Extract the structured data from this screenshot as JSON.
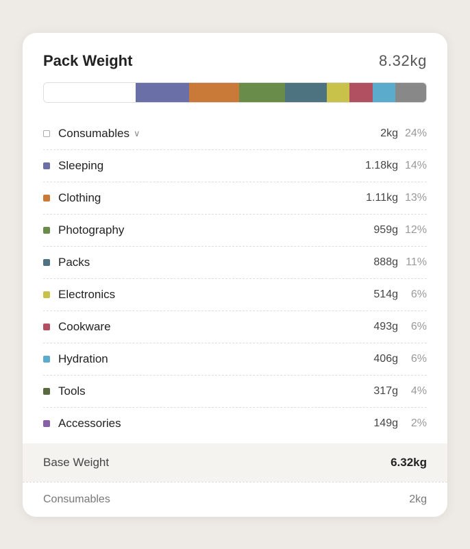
{
  "header": {
    "title": "Pack Weight",
    "total_weight": "8.32kg"
  },
  "bar": {
    "segments": [
      {
        "color": "#ffffff",
        "flex": 24,
        "border": true
      },
      {
        "color": "#6b6fa8",
        "flex": 14
      },
      {
        "color": "#c97a38",
        "flex": 13
      },
      {
        "color": "#6a8c4a",
        "flex": 12
      },
      {
        "color": "#4e7380",
        "flex": 11
      },
      {
        "color": "#c8c14a",
        "flex": 6
      },
      {
        "color": "#b05060",
        "flex": 6
      },
      {
        "color": "#5aabcc",
        "flex": 6
      },
      {
        "color": "#888",
        "flex": 8
      }
    ]
  },
  "items": [
    {
      "name": "Consumables",
      "has_chevron": true,
      "color": "#ffffff",
      "color_border": "#aaa",
      "weight": "2kg",
      "percent": "24%"
    },
    {
      "name": "Sleeping",
      "has_chevron": false,
      "color": "#6b6fa8",
      "weight": "1.18kg",
      "percent": "14%"
    },
    {
      "name": "Clothing",
      "has_chevron": false,
      "color": "#c97a38",
      "weight": "1.11kg",
      "percent": "13%"
    },
    {
      "name": "Photography",
      "has_chevron": false,
      "color": "#6a8c4a",
      "weight": "959g",
      "percent": "12%"
    },
    {
      "name": "Packs",
      "has_chevron": false,
      "color": "#4e7380",
      "weight": "888g",
      "percent": "11%"
    },
    {
      "name": "Electronics",
      "has_chevron": false,
      "color": "#c8c14a",
      "weight": "514g",
      "percent": "6%"
    },
    {
      "name": "Cookware",
      "has_chevron": false,
      "color": "#b05060",
      "weight": "493g",
      "percent": "6%"
    },
    {
      "name": "Hydration",
      "has_chevron": false,
      "color": "#5aabcc",
      "weight": "406g",
      "percent": "6%"
    },
    {
      "name": "Tools",
      "has_chevron": false,
      "color": "#5a6a40",
      "weight": "317g",
      "percent": "4%"
    },
    {
      "name": "Accessories",
      "has_chevron": false,
      "color": "#8860a8",
      "weight": "149g",
      "percent": "2%"
    }
  ],
  "footer": {
    "base_label": "Base Weight",
    "base_value": "6.32kg",
    "consumables_label": "Consumables",
    "consumables_value": "2kg"
  },
  "chevron_symbol": "∨"
}
